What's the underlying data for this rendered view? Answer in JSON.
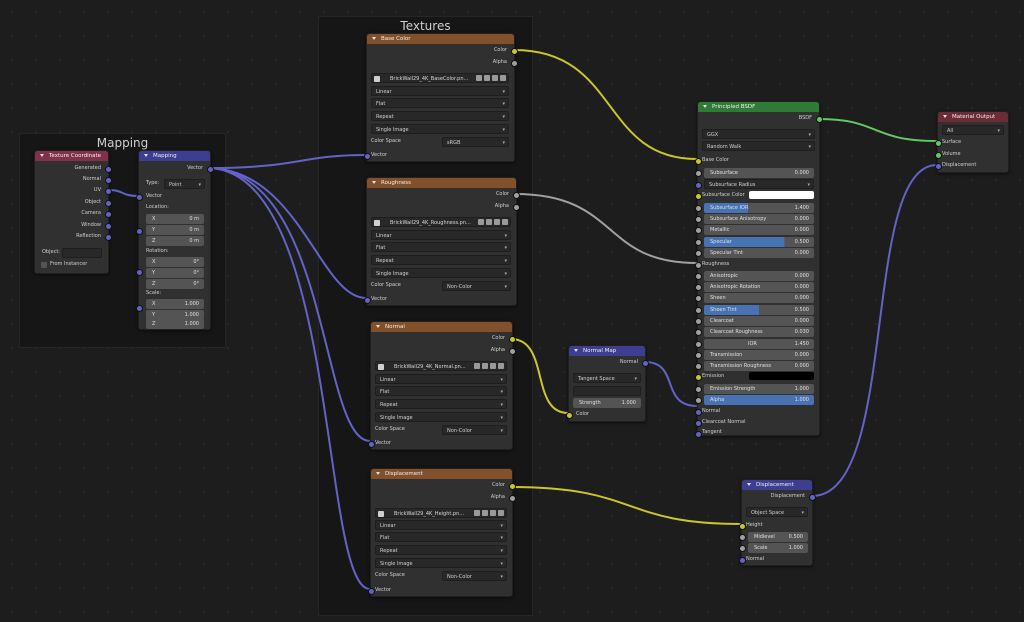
{
  "frames": {
    "textures_title": "Textures",
    "mapping_title": "Mapping"
  },
  "texture_coordinate": {
    "title": "Texture Coordinate",
    "outputs": [
      "Generated",
      "Normal",
      "UV",
      "Object",
      "Camera",
      "Window",
      "Reflection"
    ],
    "object_label": "Object:",
    "from_instancer": "From Instancer"
  },
  "mapping": {
    "title": "Mapping",
    "out_vector": "Vector",
    "type_label": "Type:",
    "type_value": "Point",
    "in_vector": "Vector",
    "location_label": "Location:",
    "location": [
      {
        "a": "X",
        "v": "0 m"
      },
      {
        "a": "Y",
        "v": "0 m"
      },
      {
        "a": "Z",
        "v": "0 m"
      }
    ],
    "rotation_label": "Rotation:",
    "rotation": [
      {
        "a": "X",
        "v": "0°"
      },
      {
        "a": "Y",
        "v": "0°"
      },
      {
        "a": "Z",
        "v": "0°"
      }
    ],
    "scale_label": "Scale:",
    "scale": [
      {
        "a": "X",
        "v": "1.000"
      },
      {
        "a": "Y",
        "v": "1.000"
      },
      {
        "a": "Z",
        "v": "1.000"
      }
    ]
  },
  "tex_base": {
    "title": "Base Color",
    "out_color": "Color",
    "out_alpha": "Alpha",
    "image": "BrickWall29_4K_BaseColor.pn...",
    "interp": "Linear",
    "proj": "Flat",
    "ext": "Repeat",
    "src": "Single Image",
    "cs_label": "Color Space",
    "cs_value": "sRGB",
    "in_vector": "Vector"
  },
  "tex_rough": {
    "title": "Roughness",
    "out_color": "Color",
    "out_alpha": "Alpha",
    "image": "BrickWall29_4K_Roughness.pn...",
    "interp": "Linear",
    "proj": "Flat",
    "ext": "Repeat",
    "src": "Single Image",
    "cs_label": "Color Space",
    "cs_value": "Non-Color",
    "in_vector": "Vector"
  },
  "tex_normal": {
    "title": "Normal",
    "out_color": "Color",
    "out_alpha": "Alpha",
    "image": "BrickWall29_4K_Normal.pn...",
    "interp": "Linear",
    "proj": "Flat",
    "ext": "Repeat",
    "src": "Single Image",
    "cs_label": "Color Space",
    "cs_value": "Non-Color",
    "in_vector": "Vector"
  },
  "tex_disp": {
    "title": "Displacement",
    "out_color": "Color",
    "out_alpha": "Alpha",
    "image": "BrickWall29_4K_Height.pn...",
    "interp": "Linear",
    "proj": "Flat",
    "ext": "Repeat",
    "src": "Single Image",
    "cs_label": "Color Space",
    "cs_value": "Non-Color",
    "in_vector": "Vector"
  },
  "normal_map": {
    "title": "Normal Map",
    "out_normal": "Normal",
    "space": "Tangent Space",
    "strength_label": "Strength",
    "strength_value": "1.000",
    "in_color": "Color"
  },
  "bsdf": {
    "title": "Principled BSDF",
    "out": "BSDF",
    "dist": "GGX",
    "sss_method": "Random Walk",
    "base_color": "Base Color",
    "subsurface": {
      "l": "Subsurface",
      "v": "0.000"
    },
    "subsurface_radius": "Subsurface Radius",
    "subsurface_color": "Subsurface Color",
    "fields_a": [
      {
        "l": "Subsurface IOR",
        "v": "1.400"
      },
      {
        "l": "Subsurface Anisotropy",
        "v": "0.000"
      },
      {
        "l": "Metallic",
        "v": "0.000"
      },
      {
        "l": "Specular",
        "v": "0.500"
      },
      {
        "l": "Specular Tint",
        "v": "0.000"
      }
    ],
    "roughness": "Roughness",
    "fields_b": [
      {
        "l": "Anisotropic",
        "v": "0.000"
      },
      {
        "l": "Anisotropic Rotation",
        "v": "0.000"
      },
      {
        "l": "Sheen",
        "v": "0.000"
      },
      {
        "l": "Sheen Tint",
        "v": "0.500"
      },
      {
        "l": "Clearcoat",
        "v": "0.000"
      },
      {
        "l": "Clearcoat Roughness",
        "v": "0.030"
      },
      {
        "l": "IOR",
        "v": "1.450"
      },
      {
        "l": "Transmission",
        "v": "0.000"
      },
      {
        "l": "Transmission Roughness",
        "v": "0.000"
      }
    ],
    "emission": "Emission",
    "emission_strength": {
      "l": "Emission Strength",
      "v": "1.000"
    },
    "alpha": {
      "l": "Alpha",
      "v": "1.000"
    },
    "normal": "Normal",
    "clearcoat_normal": "Clearcoat Normal",
    "tangent": "Tangent"
  },
  "material_output": {
    "title": "Material Output",
    "target": "All",
    "surface": "Surface",
    "volume": "Volume",
    "displacement": "Displacement"
  },
  "displacement": {
    "title": "Displacement",
    "out": "Displacement",
    "space": "Object Space",
    "height": "Height",
    "midlevel": {
      "l": "Midlevel",
      "v": "0.500"
    },
    "scale": {
      "l": "Scale",
      "v": "1.000"
    },
    "normal": "Normal"
  },
  "colors": {
    "link_color": "#c7c729",
    "link_gray": "#a1a1a1",
    "link_vector": "#6363c7",
    "link_shader": "#63c763",
    "accent_blue": "#4772b3"
  }
}
